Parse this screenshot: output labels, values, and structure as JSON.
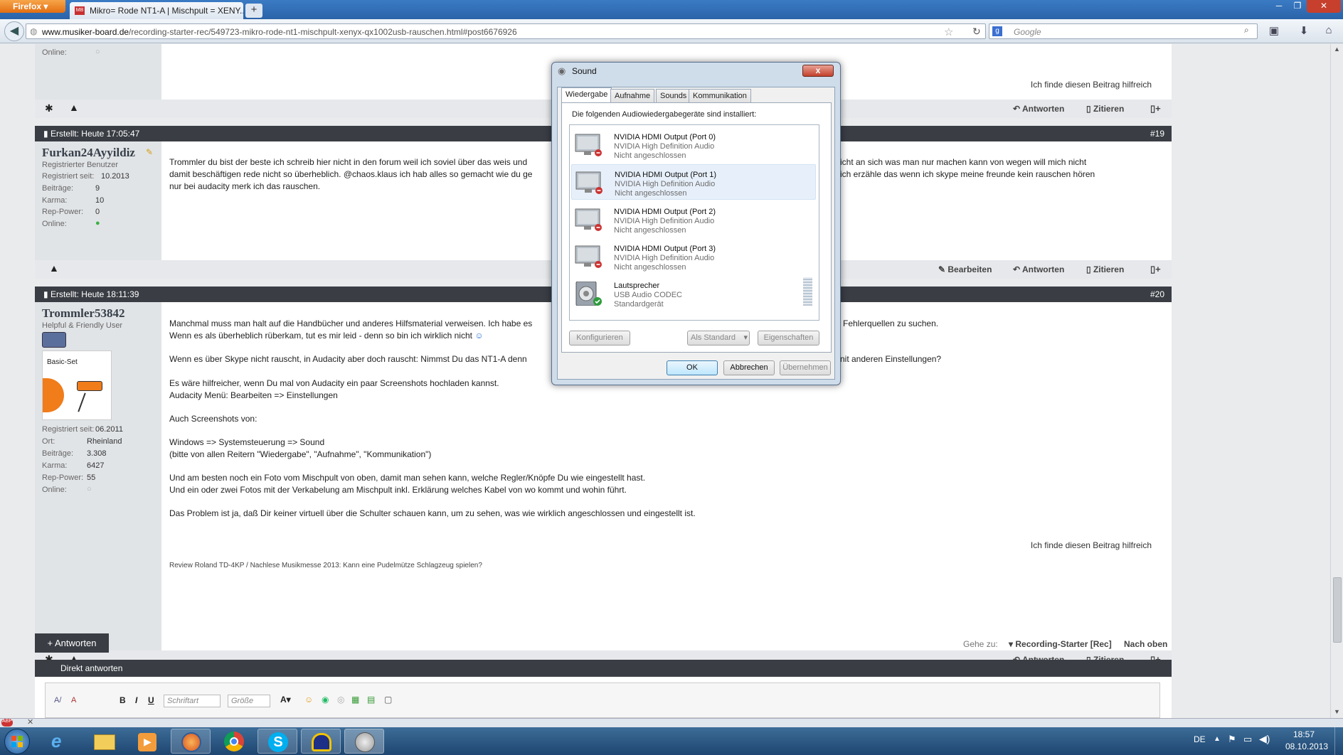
{
  "browser": {
    "menu_button": "Firefox",
    "tab_title": "Mikro= Rode NT1-A | Mischpult = XENY...",
    "tab_favicon": "MB",
    "new_tab": "+",
    "url_domain": "www.musiker-board.de",
    "url_path": "/recording-starter-rec/549723-mikro-rode-nt1-mischpult-xenyx-qx1002usb-rauschen.html#post6676926",
    "search_placeholder": "Google"
  },
  "prev_post": {
    "online_label": "Online:",
    "helpful": "Ich finde diesen Beitrag hilfreich",
    "actions": {
      "reply": "Antworten",
      "quote": "Zitieren"
    }
  },
  "post19": {
    "created": "Erstellt: Heute 17:05:47",
    "number": "#19",
    "username": "Furkan24Ayyildiz",
    "rank": "Registrierter Benutzer",
    "info": [
      {
        "label": "Registriert seit:",
        "value": "10.2013"
      },
      {
        "label": "Beiträge:",
        "value": "9"
      },
      {
        "label": "Karma:",
        "value": "10"
      },
      {
        "label": "Rep-Power:",
        "value": "0"
      },
      {
        "label": "Online:",
        "value": ""
      }
    ],
    "text_left": [
      "Trommler du bist der beste ich schreib hier nicht in den forum weil ich soviel über das weis und",
      "damit beschäftigen rede nicht so überheblich. @chaos.klaus ich hab alles so gemacht wie du ge",
      "nur bei audacity merk ich das rauschen."
    ],
    "text_right": [
      "icht an sich was man nur machen kann von wegen will mich nicht",
      "ich erzähle das wenn ich skype meine freunde kein rauschen hören"
    ],
    "actions": {
      "edit": "Bearbeiten",
      "reply": "Antworten",
      "quote": "Zitieren"
    }
  },
  "post20": {
    "created": "Erstellt: Heute 18:11:39",
    "number": "#20",
    "username": "Trommler53842",
    "rank": "Helpful & Friendly User",
    "badge_label": "Basic-Set",
    "info": [
      {
        "label": "Registriert seit:",
        "value": "06.2011"
      },
      {
        "label": "Ort:",
        "value": "Rheinland"
      },
      {
        "label": "Beiträge:",
        "value": "3.308"
      },
      {
        "label": "Karma:",
        "value": "6427"
      },
      {
        "label": "Rep-Power:",
        "value": "55"
      },
      {
        "label": "Online:",
        "value": ""
      }
    ],
    "lines": [
      "Manchmal muss man halt auf die Handbücher und anderes Hilfsmaterial verweisen. Ich habe es",
      "Wenn es als überheblich rüberkam, tut es mir leid - denn so bin ich wirklich nicht",
      "Wenn es über Skype nicht rauscht, in Audacity aber doch rauscht: Nimmst Du das NT1-A denn",
      "Es wäre hilfreicher, wenn Du mal von Audacity ein paar Screenshots hochladen kannst.",
      "Audacity Menü: Bearbeiten => Einstellungen",
      "Auch Screenshots von:",
      "Windows => Systemsteuerung => Sound",
      "(bitte von allen Reitern \"Wiedergabe\", \"Aufnahme\", \"Kommunikation\")",
      "Und am besten noch ein Foto vom Mischpult von oben, damit man sehen kann, welche Regler/Knöpfe Du wie eingestellt hast.",
      "Und ein oder zwei Fotos mit der Verkabelung am Mischpult inkl. Erklärung welches Kabel von wo kommt und wohin führt.",
      "Das Problem ist ja, daß Dir keiner virtuell über die Schulter schauen kann, um zu sehen, was wie wirklich angeschlossen und eingestellt ist."
    ],
    "right_fragments": [
      "Fehlerquellen zu suchen.",
      "nit anderen Einstellungen?"
    ],
    "helpful": "Ich finde diesen Beitrag hilfreich",
    "signature": "Review Roland TD-4KP / Nachlese Musikmesse 2013: Kann eine Pudelmütze Schlagzeug spielen?",
    "actions": {
      "reply": "Antworten",
      "quote": "Zitieren"
    }
  },
  "page_nav": {
    "reply_button": "+ Antworten",
    "goto_label": "Gehe zu:",
    "goto_value": "Recording-Starter [Rec]",
    "top_link": "Nach oben"
  },
  "quick_reply": {
    "title": "Direkt antworten",
    "font_placeholder": "Schriftart",
    "size_placeholder": "Größe"
  },
  "dialog": {
    "title": "Sound",
    "close": "x",
    "tabs": [
      "Wiedergabe",
      "Aufnahme",
      "Sounds",
      "Kommunikation"
    ],
    "intro": "Die folgenden Audiowiedergabegeräte sind installiert:",
    "devices": [
      {
        "name": "NVIDIA HDMI Output (Port 0)",
        "driver": "NVIDIA High Definition Audio",
        "status": "Nicht angeschlossen"
      },
      {
        "name": "NVIDIA HDMI Output (Port 1)",
        "driver": "NVIDIA High Definition Audio",
        "status": "Nicht angeschlossen"
      },
      {
        "name": "NVIDIA HDMI Output (Port 2)",
        "driver": "NVIDIA High Definition Audio",
        "status": "Nicht angeschlossen"
      },
      {
        "name": "NVIDIA HDMI Output (Port 3)",
        "driver": "NVIDIA High Definition Audio",
        "status": "Nicht angeschlossen"
      },
      {
        "name": "Lautsprecher",
        "driver": "USB Audio CODEC",
        "status": "Standardgerät"
      }
    ],
    "buttons": {
      "configure": "Konfigurieren",
      "set_default": "Als Standard",
      "properties": "Eigenschaften",
      "ok": "OK",
      "cancel": "Abbrechen",
      "apply": "Übernehmen"
    }
  },
  "taskbar": {
    "language": "DE",
    "time": "18:57",
    "date": "08.10.2013"
  },
  "colors": {
    "postbar": "#3a3e44",
    "taskbar": "#1e4670",
    "tabbar": "#2a63a8"
  }
}
